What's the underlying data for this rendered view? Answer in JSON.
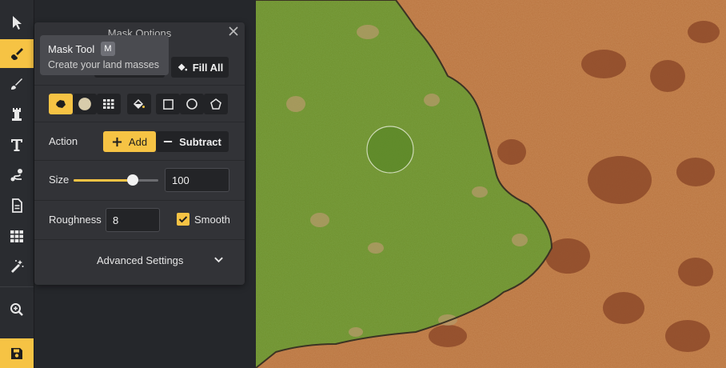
{
  "toolbar": {
    "items": [
      {
        "name": "select-tool-button",
        "icon": "cursor-arrow-icon"
      },
      {
        "name": "mask-tool-button",
        "icon": "mask-brush-icon",
        "active": true
      },
      {
        "name": "paint-tool-button",
        "icon": "paint-brush-icon"
      },
      {
        "name": "objects-tool-button",
        "icon": "castle-tower-icon"
      },
      {
        "name": "text-tool-button",
        "icon": "text-t-icon"
      },
      {
        "name": "path-tool-button",
        "icon": "path-route-icon"
      },
      {
        "name": "notes-tool-button",
        "icon": "document-icon"
      },
      {
        "name": "grid-tool-button",
        "icon": "grid-icon"
      },
      {
        "name": "effects-tool-button",
        "icon": "magic-wand-icon"
      },
      {
        "name": "zoom-tool-button",
        "icon": "zoom-icon"
      },
      {
        "name": "save-button",
        "icon": "save-disk-icon"
      }
    ]
  },
  "tooltip": {
    "title": "Mask Tool",
    "shortcut": "M",
    "description": "Create your land masses"
  },
  "panel": {
    "title": "Mask Options",
    "fill_all_label": "Fill All",
    "shape_buttons": [
      "freeform-brush-icon",
      "circle-brush-icon",
      "grid-brush-icon",
      "fill-bucket-icon",
      "square-shape-icon",
      "circle-shape-icon",
      "pentagon-shape-icon"
    ],
    "action_label": "Action",
    "add_label": "Add",
    "subtract_label": "Subtract",
    "size_label": "Size",
    "size_value": "100",
    "size_slider_fraction": 0.7,
    "roughness_label": "Roughness",
    "roughness_value": "8",
    "smooth_label": "Smooth",
    "smooth_checked": true,
    "advanced_label": "Advanced Settings"
  },
  "colors": {
    "accent": "#f6c344",
    "grass": "#6e8f2c",
    "desert": "#b86f3a"
  }
}
